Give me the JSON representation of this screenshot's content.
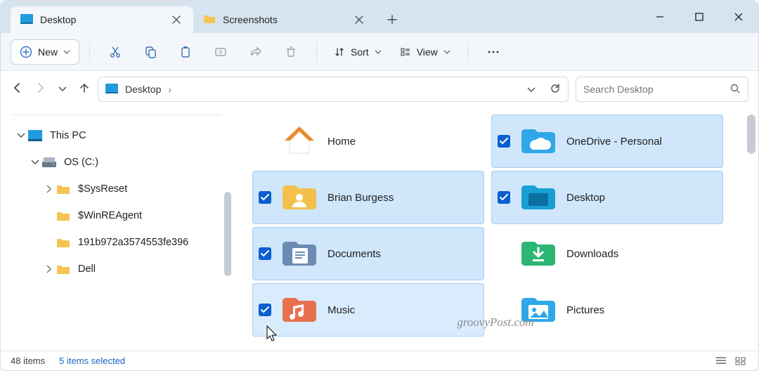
{
  "tabs": [
    {
      "label": "Desktop",
      "active": true
    },
    {
      "label": "Screenshots",
      "active": false
    }
  ],
  "toolbar": {
    "new_label": "New",
    "sort_label": "Sort",
    "view_label": "View"
  },
  "address": {
    "location": "Desktop",
    "sep": "›"
  },
  "search": {
    "placeholder": "Search Desktop"
  },
  "sidebar": {
    "items": [
      {
        "label": "This PC",
        "depth": 0,
        "expanded": true,
        "icon": "pc"
      },
      {
        "label": "OS (C:)",
        "depth": 1,
        "expanded": true,
        "icon": "drive"
      },
      {
        "label": "$SysReset",
        "depth": 2,
        "expanded": false,
        "chevron": true,
        "icon": "folder"
      },
      {
        "label": "$WinREAgent",
        "depth": 2,
        "expanded": false,
        "chevron": false,
        "icon": "folder"
      },
      {
        "label": "191b972a3574553fe396",
        "depth": 2,
        "expanded": false,
        "chevron": false,
        "icon": "folder"
      },
      {
        "label": "Dell",
        "depth": 2,
        "expanded": false,
        "chevron": true,
        "icon": "folder"
      }
    ]
  },
  "items": [
    {
      "label": "Home",
      "icon": "home",
      "selected": false
    },
    {
      "label": "OneDrive - Personal",
      "icon": "onedrive",
      "selected": true
    },
    {
      "label": "Brian Burgess",
      "icon": "user-folder",
      "selected": true
    },
    {
      "label": "Desktop",
      "icon": "desktop-folder",
      "selected": true
    },
    {
      "label": "Documents",
      "icon": "documents",
      "selected": true
    },
    {
      "label": "Downloads",
      "icon": "downloads",
      "selected": false
    },
    {
      "label": "Music",
      "icon": "music",
      "selected": true,
      "hover": true
    },
    {
      "label": "Pictures",
      "icon": "pictures",
      "selected": false
    }
  ],
  "status": {
    "count_text": "48 items",
    "selected_text": "5 items selected"
  },
  "watermark": "groovyPost.com"
}
